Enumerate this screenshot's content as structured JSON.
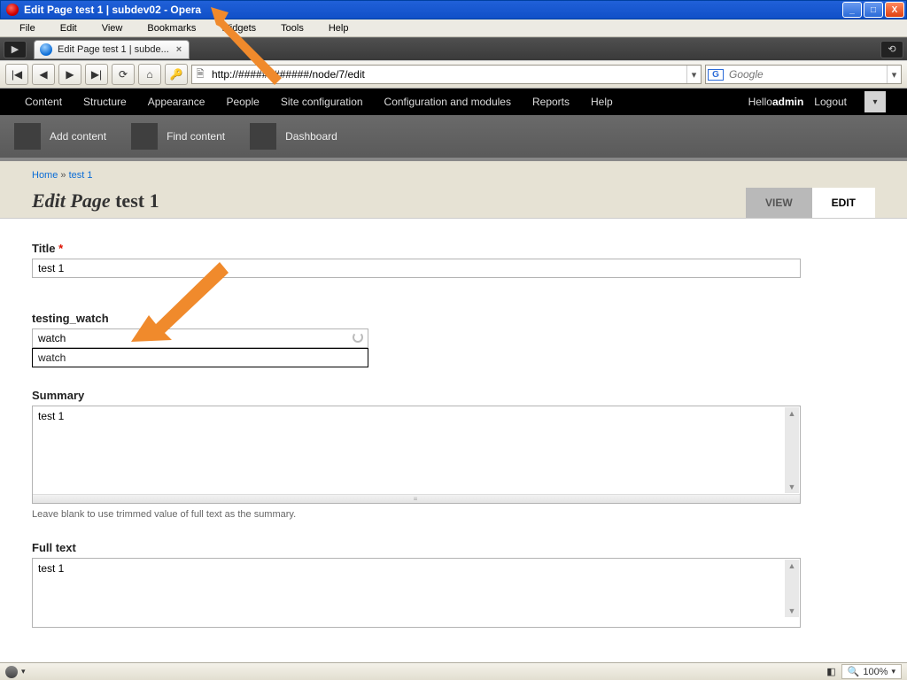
{
  "window": {
    "title": "Edit Page test 1  |  subdev02 - Opera",
    "buttons": {
      "min": "_",
      "max": "□",
      "close": "X"
    }
  },
  "menu": [
    "File",
    "Edit",
    "View",
    "Bookmarks",
    "Widgets",
    "Tools",
    "Help"
  ],
  "tab": {
    "label": "Edit Page test 1 | subde...",
    "close": "×"
  },
  "nav": {
    "url": "http://############/node/7/edit",
    "search_placeholder": "Google"
  },
  "admin": {
    "items": [
      "Content",
      "Structure",
      "Appearance",
      "People",
      "Site configuration",
      "Configuration and modules",
      "Reports",
      "Help"
    ],
    "hello": "Hello ",
    "user": "admin",
    "logout": "Logout"
  },
  "shortcuts": [
    "Add content",
    "Find content",
    "Dashboard"
  ],
  "crumbs": {
    "home": "Home",
    "sep": "»",
    "page": "test 1"
  },
  "heading": {
    "prefix": "Edit Page",
    "rest": " test 1"
  },
  "local_tabs": {
    "view": "VIEW",
    "edit": "EDIT"
  },
  "form": {
    "title_label": "Title ",
    "title_value": "test 1",
    "watch_label": "testing_watch",
    "watch_value": "watch",
    "watch_option": "watch",
    "summary_label": "Summary",
    "summary_value": "test 1",
    "summary_desc": "Leave blank to use trimmed value of full text as the summary.",
    "fulltext_label": "Full text",
    "fulltext_value": "test 1",
    "required_marker": "*"
  },
  "status": {
    "zoom_label": "100%"
  }
}
